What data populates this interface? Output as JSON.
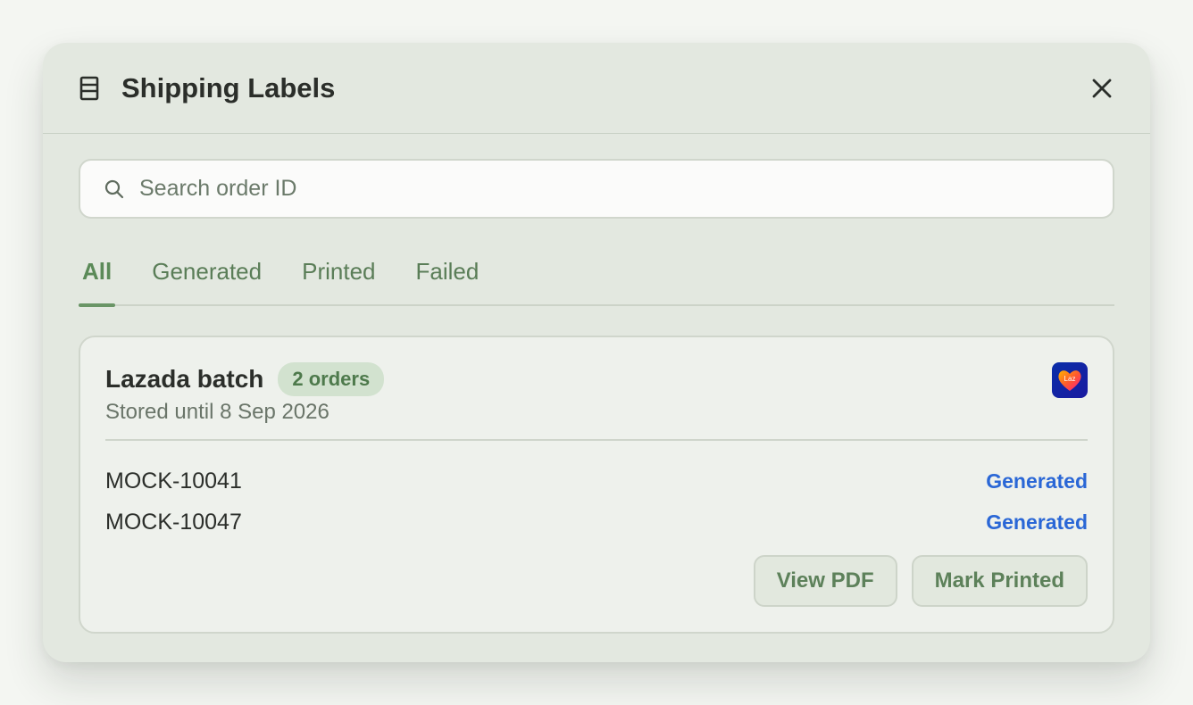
{
  "header": {
    "title": "Shipping Labels",
    "title_icon": "document-list-icon",
    "close_icon": "close-icon"
  },
  "search": {
    "placeholder": "Search order ID",
    "value": "",
    "icon": "search-icon"
  },
  "tabs": [
    {
      "label": "All",
      "active": true
    },
    {
      "label": "Generated",
      "active": false
    },
    {
      "label": "Printed",
      "active": false
    },
    {
      "label": "Failed",
      "active": false
    }
  ],
  "batch": {
    "title": "Lazada batch",
    "badge": "2 orders",
    "stored": "Stored until 8 Sep 2026",
    "logo_text": "Laz",
    "orders": [
      {
        "id": "MOCK-10041",
        "status": "Generated"
      },
      {
        "id": "MOCK-10047",
        "status": "Generated"
      }
    ],
    "actions": {
      "view_pdf": "View PDF",
      "mark_printed": "Mark Printed"
    }
  },
  "colors": {
    "accent": "#5b8a58",
    "status_generated": "#2a67d6",
    "modal_bg": "#e3e8e0"
  }
}
